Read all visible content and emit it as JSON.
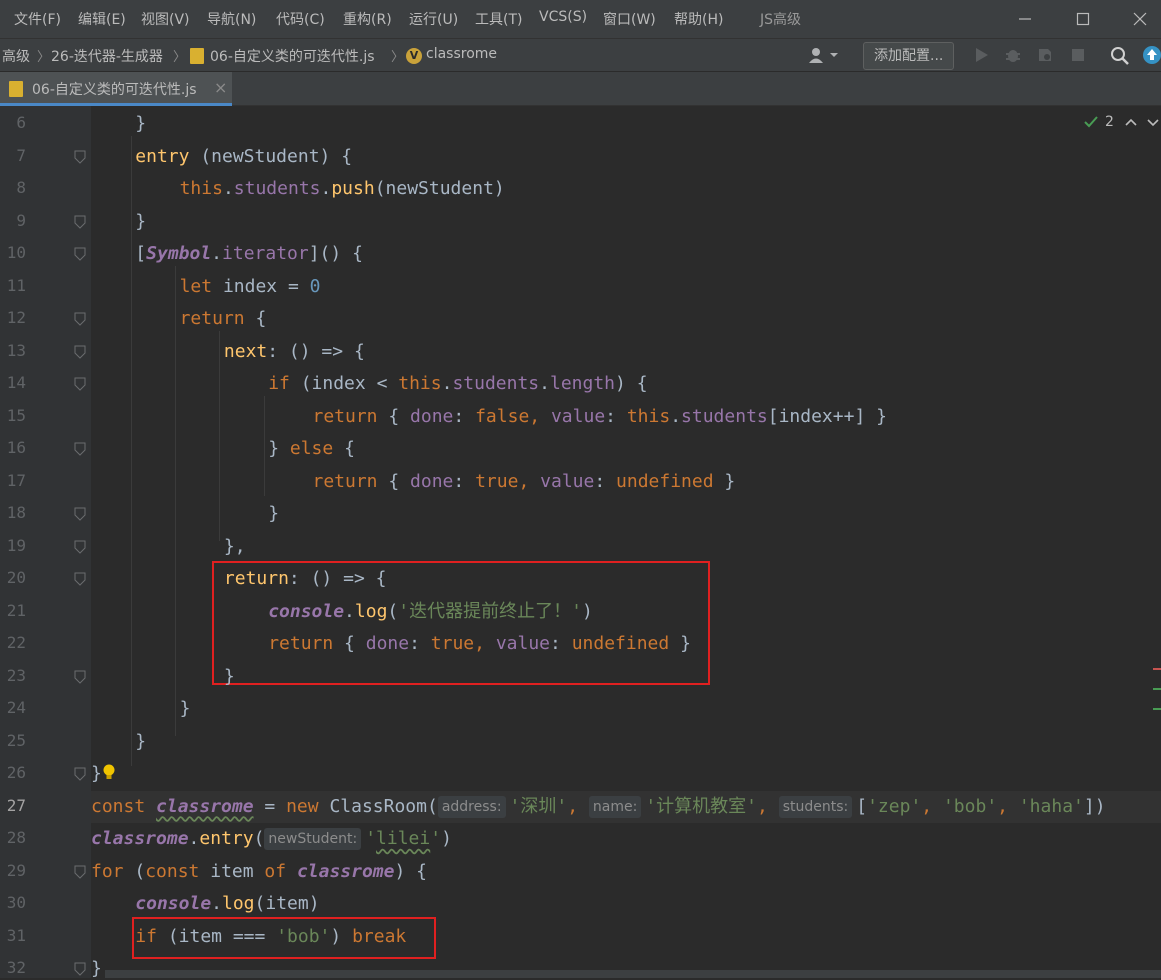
{
  "menu": [
    "文件(F)",
    "编辑(E)",
    "视图(V)",
    "导航(N)",
    "代码(C)",
    "重构(R)",
    "运行(U)",
    "工具(T)",
    "VCS(S)",
    "窗口(W)",
    "帮助(H)"
  ],
  "window_title": "JS高级",
  "breadcrumbs": [
    "高级",
    "26-迭代器-生成器",
    "06-自定义类的可迭代性.js",
    "classrome"
  ],
  "toolbar": {
    "add_config": "添加配置...",
    "user_icon": "user-icon",
    "run_icon": "run-icon",
    "debug_icon": "debug-icon",
    "coverage_icon": "coverage-icon",
    "stop_icon": "stop-icon",
    "search_icon": "search-icon",
    "update_icon": "update-icon"
  },
  "tab": {
    "label": "06-自定义类的可迭代性.js",
    "close": "×"
  },
  "inspection": {
    "count": "2"
  },
  "lines": [
    {
      "n": "6"
    },
    {
      "n": "7"
    },
    {
      "n": "8"
    },
    {
      "n": "9"
    },
    {
      "n": "10"
    },
    {
      "n": "11"
    },
    {
      "n": "12"
    },
    {
      "n": "13"
    },
    {
      "n": "14"
    },
    {
      "n": "15"
    },
    {
      "n": "16"
    },
    {
      "n": "17"
    },
    {
      "n": "18"
    },
    {
      "n": "19"
    },
    {
      "n": "20"
    },
    {
      "n": "21"
    },
    {
      "n": "22"
    },
    {
      "n": "23"
    },
    {
      "n": "24"
    },
    {
      "n": "25"
    },
    {
      "n": "26"
    },
    {
      "n": "27"
    },
    {
      "n": "28"
    },
    {
      "n": "29"
    },
    {
      "n": "30"
    },
    {
      "n": "31"
    },
    {
      "n": "32"
    }
  ],
  "code": {
    "l6": [
      "}"
    ],
    "l7": [
      "entry",
      " (newStudent) {"
    ],
    "l8": [
      "this",
      ".",
      "students",
      ".",
      "push",
      "(newStudent)"
    ],
    "l9": [
      "}"
    ],
    "l10": [
      "[",
      "Symbol",
      ".",
      "iterator",
      "]() {"
    ],
    "l11": [
      "let",
      " index = ",
      "0"
    ],
    "l12": [
      "return",
      " {"
    ],
    "l13": [
      "next",
      ": () => {"
    ],
    "l14": [
      "if",
      " (index < ",
      "this",
      ".",
      "students",
      ".",
      "length",
      ") {"
    ],
    "l15": [
      "return",
      " { ",
      "done",
      ": ",
      "false",
      ", ",
      "value",
      ": ",
      "this",
      ".",
      "students",
      "[index++] }"
    ],
    "l16": [
      "} ",
      "else",
      " {"
    ],
    "l17": [
      "return",
      " { ",
      "done",
      ": ",
      "true",
      ", ",
      "value",
      ": ",
      "undefined",
      " }"
    ],
    "l18": [
      "}"
    ],
    "l19": [
      "},"
    ],
    "l20": [
      "return",
      ": () => {"
    ],
    "l21": [
      "console",
      ".",
      "log",
      "(",
      "'迭代器提前终止了！'",
      ")"
    ],
    "l22": [
      "return",
      " { ",
      "done",
      ": ",
      "true",
      ", ",
      "value",
      ": ",
      "undefined",
      " }"
    ],
    "l23": [
      "}"
    ],
    "l24": [
      "}"
    ],
    "l25": [
      "}"
    ],
    "l26": [
      "}"
    ],
    "l27": [
      "const",
      " ",
      "classrome",
      " = ",
      "new",
      " ClassRoom(",
      "address:",
      "'深圳'",
      ", ",
      "name:",
      "'计算机教室'",
      ", ",
      "students:",
      "[",
      "'zep'",
      ", ",
      "'bob'",
      ", ",
      "'haha'",
      "])"
    ],
    "l28": [
      "classrome",
      ".",
      "entry",
      "(",
      "newStudent:",
      "'",
      "lilei",
      "'",
      ")"
    ],
    "l29": [
      "for",
      " (",
      "const",
      " item ",
      "of",
      " ",
      "classrome",
      ") {"
    ],
    "l30": [
      "console",
      ".",
      "log",
      "(item)"
    ],
    "l31": [
      "if",
      " (item === ",
      "'bob'",
      ") ",
      "break"
    ],
    "l32": [
      "}"
    ]
  },
  "colors": {
    "keyword": "#cc7832",
    "function": "#ffc66d",
    "property": "#9876aa",
    "string": "#6a8759",
    "number": "#6897bb",
    "default": "#a9b7c6",
    "highlight_box": "#e02020"
  }
}
